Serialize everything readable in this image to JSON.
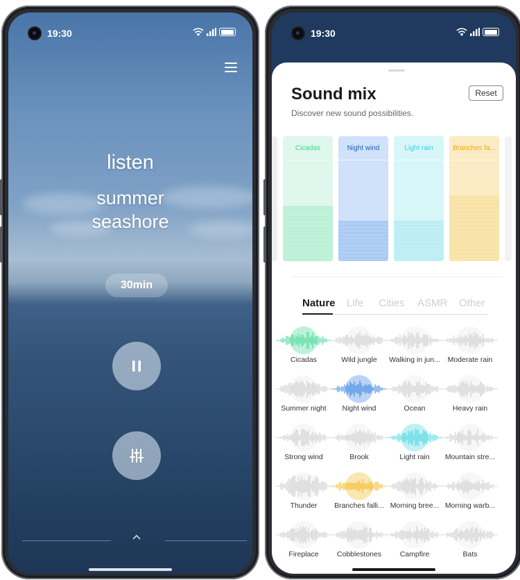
{
  "colors": {
    "accent_green": "#3bd68f",
    "accent_blue": "#2f7de0",
    "accent_cyan": "#3fd4dd",
    "accent_yellow": "#f0b416",
    "inactive_wave": "#c9c9c9"
  },
  "left": {
    "status": {
      "time": "19:30"
    },
    "title_line1": "listen",
    "title_line2": "summer",
    "title_line3": "seashore",
    "duration": "30min",
    "icons": {
      "menu": "hamburger-icon",
      "pause": "pause-icon",
      "mixer": "sliders-icon",
      "up": "chevron-up-icon"
    }
  },
  "right": {
    "status": {
      "time": "19:30"
    },
    "title": "Sound mix",
    "subtitle": "Discover new sound possibilities.",
    "reset_label": "Reset",
    "channels": [
      {
        "label": "Cicadas",
        "level": 0.55,
        "color": "#3bd68f",
        "bg": "#dff7ec",
        "fill": "#a7ecca"
      },
      {
        "label": "Night wind",
        "level": 0.4,
        "color": "#1f5fb8",
        "bg": "#cfe2fa",
        "fill": "#8fbaf0"
      },
      {
        "label": "Light rain",
        "level": 0.4,
        "color": "#3fcfe0",
        "bg": "#d7f6f8",
        "fill": "#a5e9ef"
      },
      {
        "label": "Branches fa...",
        "level": 0.65,
        "color": "#f0a800",
        "bg": "#fbecc5",
        "fill": "#f7d98a"
      }
    ],
    "tabs": [
      "Nature",
      "Life",
      "Cities",
      "ASMR",
      "Other"
    ],
    "active_tab": "Nature",
    "sounds": [
      {
        "label": "Cicadas",
        "active": true,
        "color": "#3bd68f"
      },
      {
        "label": "Wild jungle",
        "active": false
      },
      {
        "label": "Walking in jun...",
        "active": false
      },
      {
        "label": "Moderate rain",
        "active": false
      },
      {
        "label": "Summer night",
        "active": false
      },
      {
        "label": "Night wind",
        "active": true,
        "color": "#2f7de0"
      },
      {
        "label": "Ocean",
        "active": false
      },
      {
        "label": "Heavy rain",
        "active": false
      },
      {
        "label": "Strong wind",
        "active": false
      },
      {
        "label": "Brook",
        "active": false
      },
      {
        "label": "Light rain",
        "active": true,
        "color": "#3fd4dd"
      },
      {
        "label": "Mountain stre...",
        "active": false
      },
      {
        "label": "Thunder",
        "active": false
      },
      {
        "label": "Branches falli...",
        "active": true,
        "color": "#f0b416"
      },
      {
        "label": "Morning bree...",
        "active": false
      },
      {
        "label": "Morning warb...",
        "active": false
      },
      {
        "label": "Fireplace",
        "active": false
      },
      {
        "label": "Cobblestones",
        "active": false
      },
      {
        "label": "Campfire",
        "active": false
      },
      {
        "label": "Bats",
        "active": false
      }
    ]
  }
}
